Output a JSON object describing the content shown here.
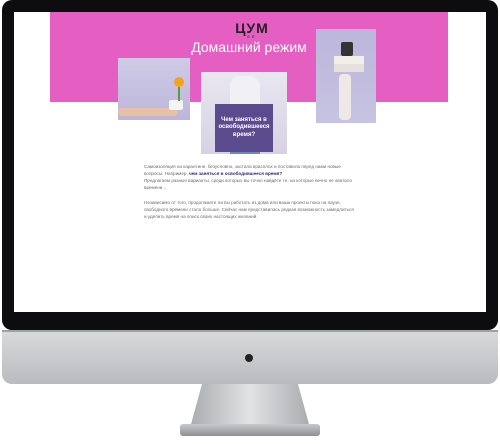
{
  "brand": {
    "logo_text": "ЦУМ",
    "logo_sub": "ЕЁ",
    "banner_color": "#e55fc2",
    "accent": "#5a4a8e"
  },
  "hero": {
    "title": "Домашний режим",
    "card_text": "Чем заняться в освободившееся время?"
  },
  "article": {
    "p1_line1": "Самоизоляция на карантине, безусловно, застала врасплох и поставила перед нами новые",
    "p1_line2_prefix": "вопросы. Например,",
    "p1_line2_highlight": "чем заняться в освободившееся время?",
    "p1_line3": "Предлагаем разные варианты, среди которых вы точно найдёте те, на которые вечно не хватало",
    "p1_line4": "времени...",
    "p2_line1": "Независимо от того, продолжаете ли вы работать из дома или ваши проекты пока на паузе,",
    "p2_line2": "свободного времени стало больше. Сейчас нам представилась редкая возможность замедлиться",
    "p2_line3": "и уделить время на поиск своих настоящих желаний."
  }
}
